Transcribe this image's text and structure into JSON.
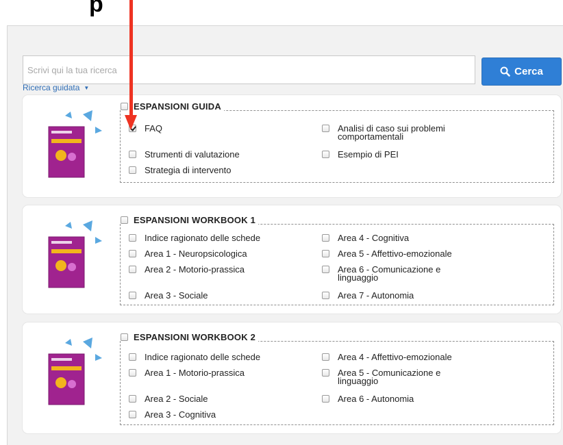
{
  "heading_fragment": "p",
  "search": {
    "placeholder": "Scrivi qui la tua ricerca",
    "button_label": "Cerca"
  },
  "guided_search": {
    "label": "Ricerca guidata",
    "caret": "▼"
  },
  "sections": [
    {
      "title": "ESPANSIONI GUIDA",
      "checked": false,
      "options": [
        {
          "label": "FAQ",
          "checked": true
        },
        {
          "label": "Analisi di caso sui problemi comportamentali",
          "checked": false
        },
        {
          "label": "Strumenti di valutazione",
          "checked": false
        },
        {
          "label": "Esempio di PEI",
          "checked": false
        },
        {
          "label": "Strategia di intervento",
          "checked": false
        }
      ]
    },
    {
      "title": "ESPANSIONI WORKBOOK 1",
      "checked": false,
      "options": [
        {
          "label": "Indice ragionato delle schede",
          "checked": false
        },
        {
          "label": "Area 4 - Cognitiva",
          "checked": false
        },
        {
          "label": "Area 1 - Neuropsicologica",
          "checked": false
        },
        {
          "label": "Area 5 - Affettivo-emozionale",
          "checked": false
        },
        {
          "label": "Area 2 - Motorio-prassica",
          "checked": false
        },
        {
          "label": "Area 6 - Comunicazione e linguaggio",
          "checked": false
        },
        {
          "label": "Area 3 - Sociale",
          "checked": false
        },
        {
          "label": "Area 7 - Autonomia",
          "checked": false
        }
      ]
    },
    {
      "title": "ESPANSIONI WORKBOOK 2",
      "checked": false,
      "options": [
        {
          "label": "Indice ragionato delle schede",
          "checked": false
        },
        {
          "label": "Area 4 - Affettivo-emozionale",
          "checked": false
        },
        {
          "label": "Area 1 - Motorio-prassica",
          "checked": false
        },
        {
          "label": "Area 5 - Comunicazione e linguaggio",
          "checked": false
        },
        {
          "label": "Area 2 - Sociale",
          "checked": false
        },
        {
          "label": "Area 6 - Autonomia",
          "checked": false
        },
        {
          "label": "Area 3 - Cognitiva",
          "checked": false
        }
      ]
    }
  ],
  "colors": {
    "accent": "#2f7fd6",
    "link": "#2f6db5",
    "annotation_arrow": "#ee3322",
    "book_cover": "#a0238f",
    "book_accent": "#f2b51d"
  }
}
